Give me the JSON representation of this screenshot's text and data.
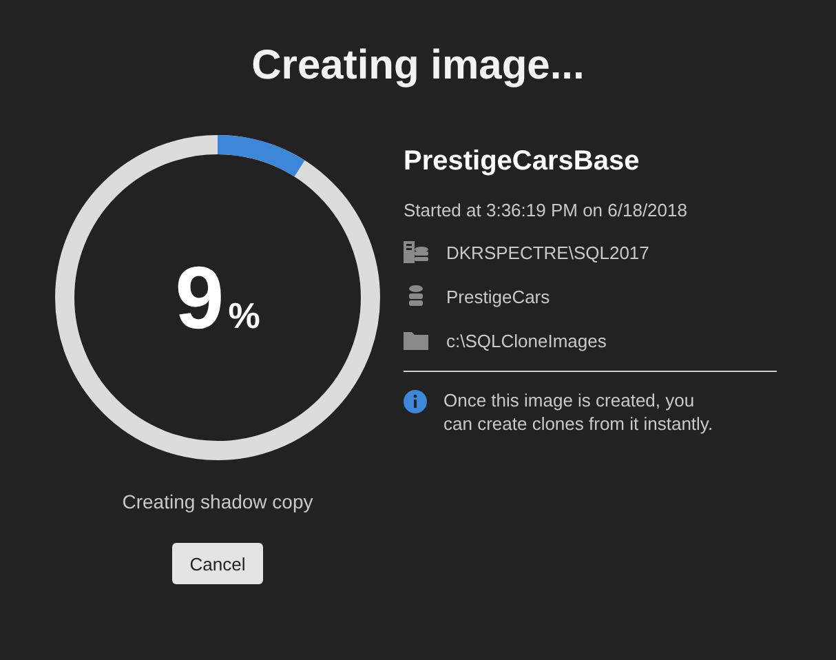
{
  "title": "Creating image...",
  "progress": {
    "value": "9",
    "unit": "%",
    "status": "Creating shadow copy"
  },
  "cancel_button": "Cancel",
  "details": {
    "name": "PrestigeCarsBase",
    "started": "Started at 3:36:19 PM on 6/18/2018",
    "items": [
      {
        "kind": "server",
        "text": "DKRSPECTRE\\SQL2017"
      },
      {
        "kind": "database",
        "text": "PrestigeCars"
      },
      {
        "kind": "folder",
        "text": "c:\\SQLCloneImages"
      }
    ],
    "info": "Once this image is created, you can create clones from it instantly."
  }
}
